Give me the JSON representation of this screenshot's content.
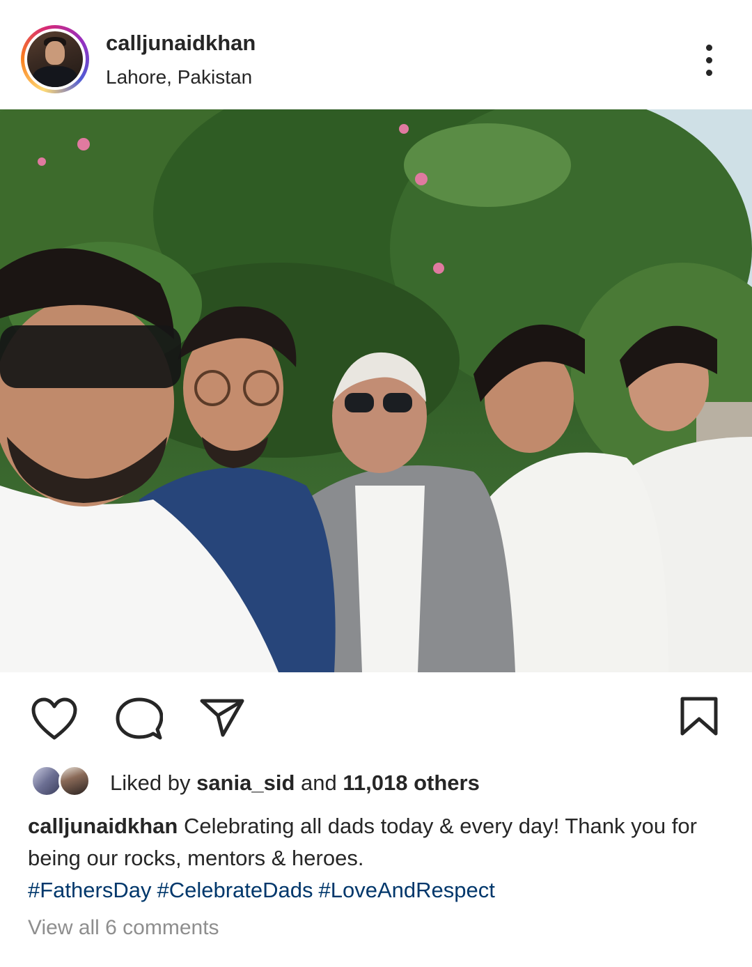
{
  "post": {
    "username": "calljunaidkhan",
    "location": "Lahore, Pakistan",
    "icons": {
      "more": "more-vertical-icon",
      "like": "heart-icon",
      "comment": "comment-bubble-icon",
      "share": "paper-plane-icon",
      "save": "bookmark-icon"
    }
  },
  "likes": {
    "prefix": "Liked by ",
    "user": "sania_sid",
    "middle": " and ",
    "count": "11,018 others"
  },
  "caption": {
    "username": "calljunaidkhan",
    "text": " Celebrating all dads today & every day! Thank you for being our rocks, mentors & heroes.",
    "hashtags": [
      "#FathersDay",
      "#CelebrateDads",
      "#LoveAndRespect"
    ]
  },
  "comments": {
    "view_all": "View all 6 comments"
  },
  "colors": {
    "text": "#262626",
    "hashtag": "#00376b",
    "muted": "#8e8e8e"
  }
}
